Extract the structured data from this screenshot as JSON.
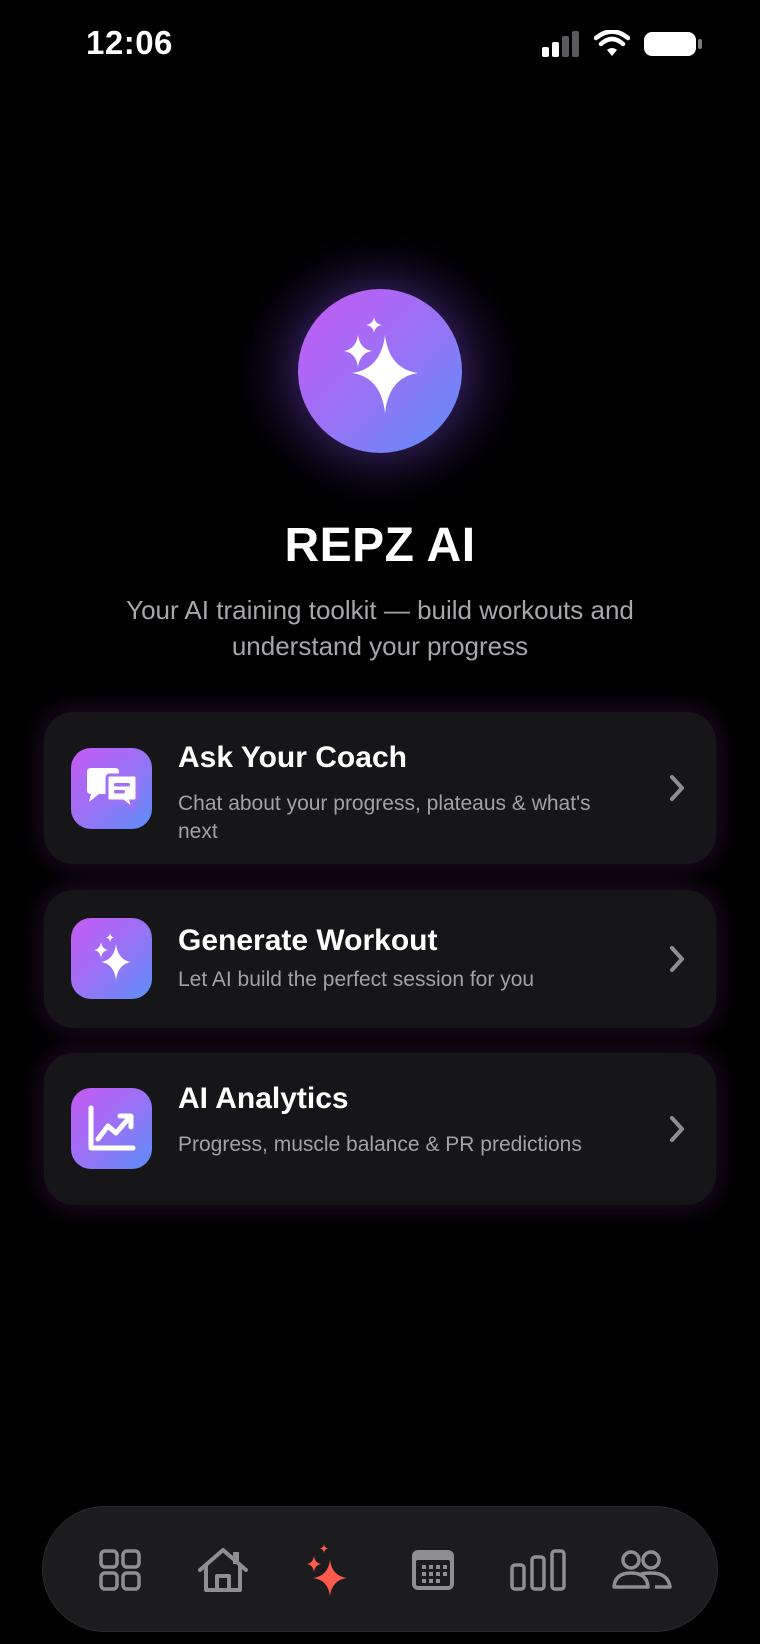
{
  "status_bar": {
    "time": "12:06",
    "icons": [
      "cellular-signal-icon",
      "wifi-icon",
      "battery-icon"
    ]
  },
  "hero": {
    "icon": "sparkles-icon",
    "title": "REPZ AI",
    "subtitle": "Your AI training toolkit — build workouts and understand your progress"
  },
  "cards": [
    {
      "icon": "chat-bubbles-icon",
      "title": "Ask Your Coach",
      "description": "Chat about your progress, plateaus & what's next"
    },
    {
      "icon": "sparkles-icon",
      "title": "Generate Workout",
      "description": "Let AI build the perfect session for you"
    },
    {
      "icon": "chart-trend-icon",
      "title": "AI Analytics",
      "description": "Progress, muscle balance & PR predictions"
    }
  ],
  "tab_bar": {
    "active_index": 2,
    "tabs": [
      {
        "icon": "grid-icon"
      },
      {
        "icon": "home-icon"
      },
      {
        "icon": "sparkles-icon"
      },
      {
        "icon": "calendar-icon"
      },
      {
        "icon": "bar-chart-icon"
      },
      {
        "icon": "people-icon"
      }
    ]
  },
  "colors": {
    "background": "#000000",
    "card": "#161618",
    "gradient_start": "#c559f4",
    "gradient_end": "#5c8ef8",
    "active_tab": "#ff5a4e",
    "inactive_tab": "#8e8e93",
    "subtitle_text": "#a6a6ab"
  }
}
